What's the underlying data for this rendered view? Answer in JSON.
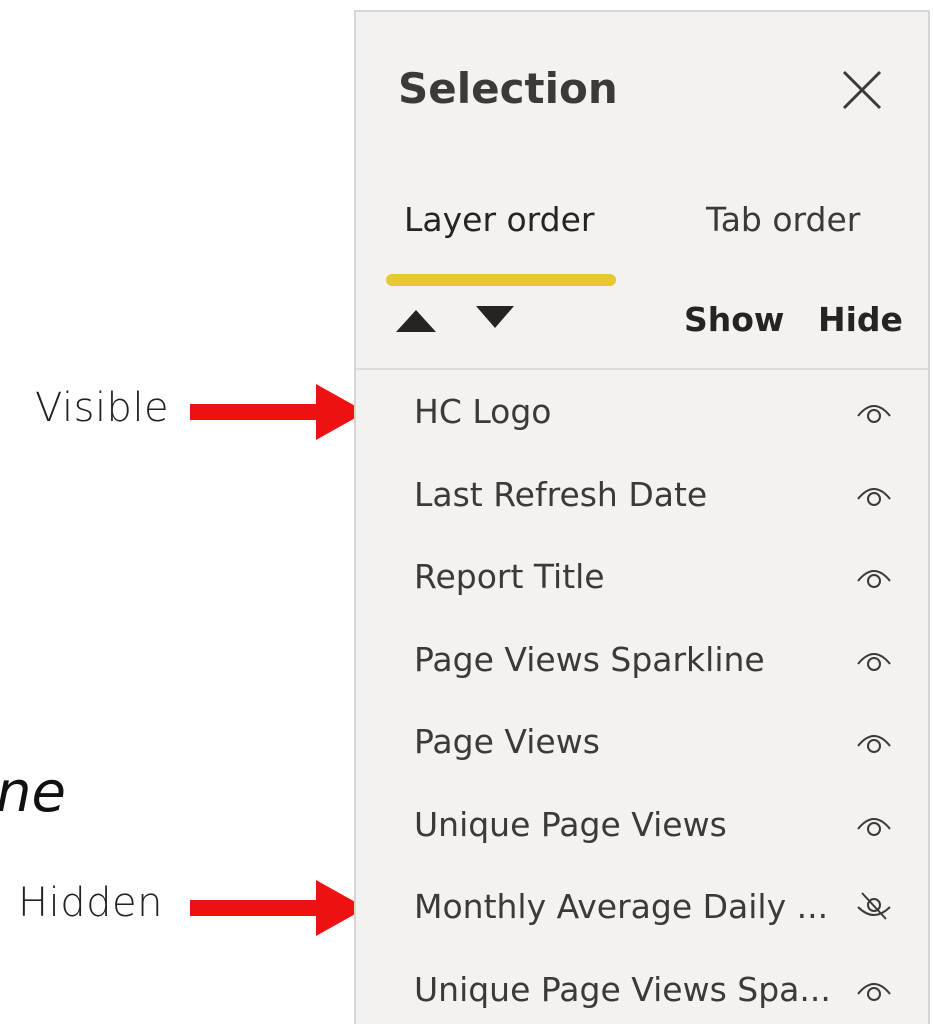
{
  "annotations": {
    "visible_label": "Visible",
    "hidden_label": "Hidden",
    "partial_text": "ne",
    "arrow_color": "#ee1111"
  },
  "panel": {
    "title": "Selection",
    "close_icon": "close-icon",
    "tabs": [
      {
        "label": "Layer order",
        "active": true
      },
      {
        "label": "Tab order",
        "active": false
      }
    ],
    "tab_indicator_color": "#e6c830",
    "toolbar": {
      "move_up_icon": "triangle-up-icon",
      "move_down_icon": "triangle-down-icon",
      "show_label": "Show",
      "hide_label": "Hide"
    },
    "layers": [
      {
        "name": "HC Logo",
        "visible": true
      },
      {
        "name": "Last Refresh Date",
        "visible": true
      },
      {
        "name": "Report Title",
        "visible": true
      },
      {
        "name": "Page Views Sparkline",
        "visible": true
      },
      {
        "name": "Page Views",
        "visible": true
      },
      {
        "name": "Unique Page Views",
        "visible": true
      },
      {
        "name": "Monthly Average Daily ...",
        "visible": false
      },
      {
        "name": "Unique Page Views Spa...",
        "visible": true
      }
    ]
  }
}
